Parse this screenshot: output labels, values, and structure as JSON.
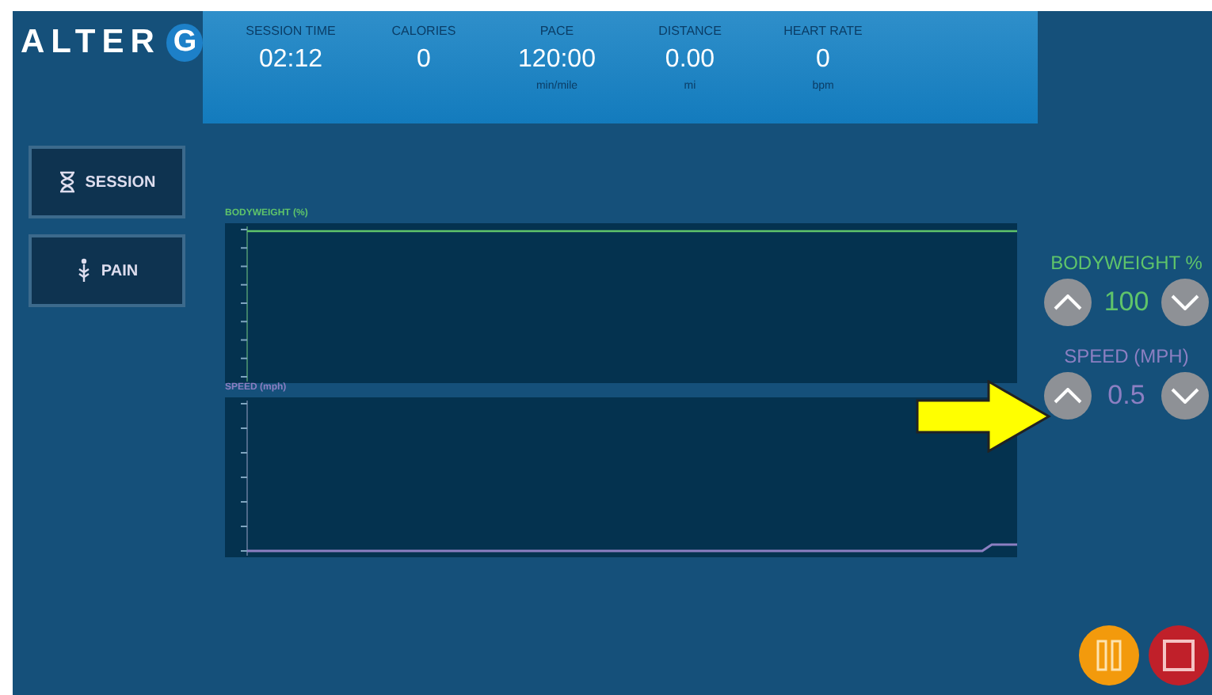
{
  "logo": {
    "text": "ALTER",
    "badge": "G"
  },
  "stats": [
    {
      "label": "SESSION TIME",
      "value": "02:12"
    },
    {
      "label": "CALORIES",
      "value": "0"
    },
    {
      "label": "PACE",
      "value": "120:00",
      "unit": "min/mile"
    },
    {
      "label": "DISTANCE",
      "value": "0.00",
      "unit": "mi"
    },
    {
      "label": "HEART RATE",
      "value": "0",
      "unit": "bpm"
    }
  ],
  "nav": [
    {
      "label": "SESSION",
      "kind": "hourglass"
    },
    {
      "label": "PAIN",
      "kind": "pain"
    }
  ],
  "charts": [
    {
      "title": "BODYWEIGHT (%)",
      "kind": "bodyweight"
    },
    {
      "title": "SPEED (mph)",
      "kind": "speed"
    }
  ],
  "controls": [
    {
      "label": "BODYWEIGHT %",
      "value": "100",
      "color": "#5fc46a"
    },
    {
      "label": "SPEED (MPH)",
      "value": "0.5",
      "color": "#8c7fc2"
    }
  ]
}
